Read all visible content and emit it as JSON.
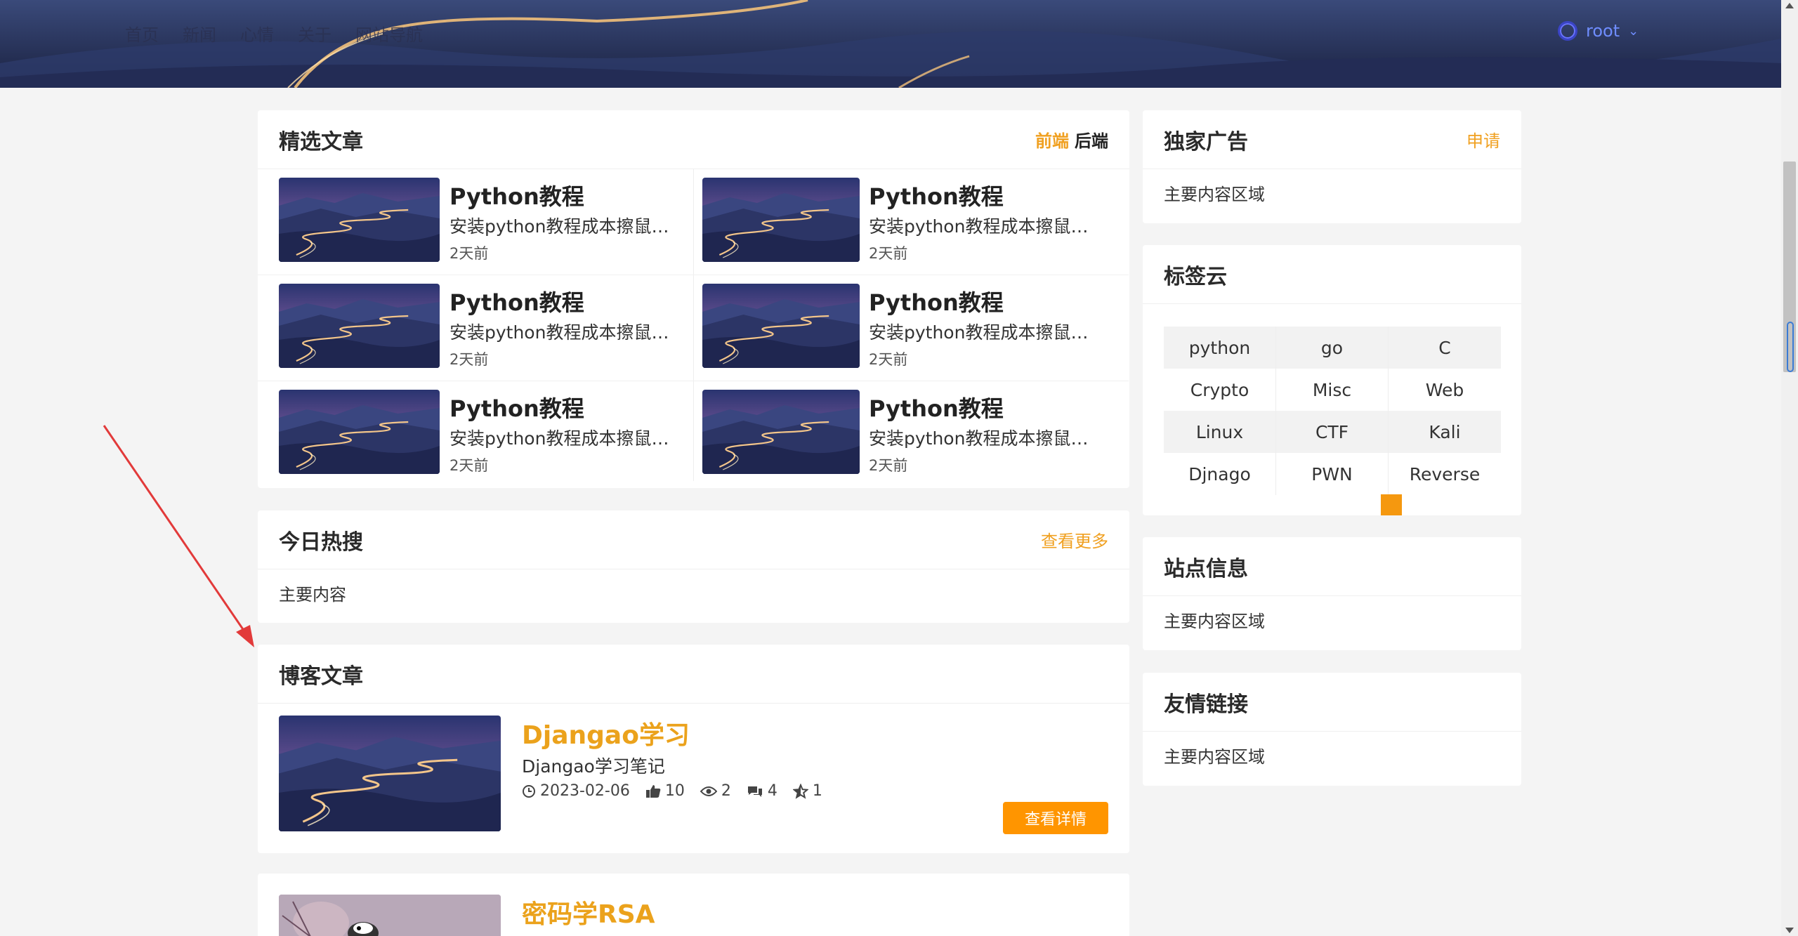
{
  "header": {
    "nav": [
      "首页",
      "新闻",
      "心情",
      "关于",
      "网站导航"
    ],
    "user": {
      "name": "root"
    }
  },
  "featured": {
    "title": "精选文章",
    "tabs": [
      "前端",
      "后端"
    ],
    "items": [
      {
        "title": "Python教程",
        "desc": "安装python教程成本擦鼠标...",
        "time": "2天前"
      },
      {
        "title": "Python教程",
        "desc": "安装python教程成本擦鼠标...",
        "time": "2天前"
      },
      {
        "title": "Python教程",
        "desc": "安装python教程成本擦鼠标...",
        "time": "2天前"
      },
      {
        "title": "Python教程",
        "desc": "安装python教程成本擦鼠标...",
        "time": "2天前"
      },
      {
        "title": "Python教程",
        "desc": "安装python教程成本擦鼠标...",
        "time": "2天前"
      },
      {
        "title": "Python教程",
        "desc": "安装python教程成本擦鼠标...",
        "time": "2天前"
      }
    ]
  },
  "hot": {
    "title": "今日热搜",
    "more": "查看更多",
    "body": "主要内容"
  },
  "blog": {
    "title": "博客文章",
    "posts": [
      {
        "title": "Djangao学习",
        "desc": "Djangao学习笔记",
        "date": "2023-02-06",
        "likes": "10",
        "views": "2",
        "comments": "4",
        "stars": "1",
        "button": "查看详情"
      },
      {
        "title": "密码学RSA"
      }
    ]
  },
  "sidebar": {
    "ad": {
      "title": "独家广告",
      "action": "申请",
      "body": "主要内容区域"
    },
    "tags": {
      "title": "标签云",
      "items": [
        "python",
        "go",
        "C",
        "Crypto",
        "Misc",
        "Web",
        "Linux",
        "CTF",
        "Kali",
        "Djnago",
        "PWN",
        "Reverse"
      ]
    },
    "site": {
      "title": "站点信息",
      "body": "主要内容区域"
    },
    "links": {
      "title": "友情链接",
      "body": "主要内容区域"
    }
  },
  "colors": {
    "accent": "#f0a020",
    "button": "#ff9500",
    "nav_user": "#6f8dff"
  }
}
